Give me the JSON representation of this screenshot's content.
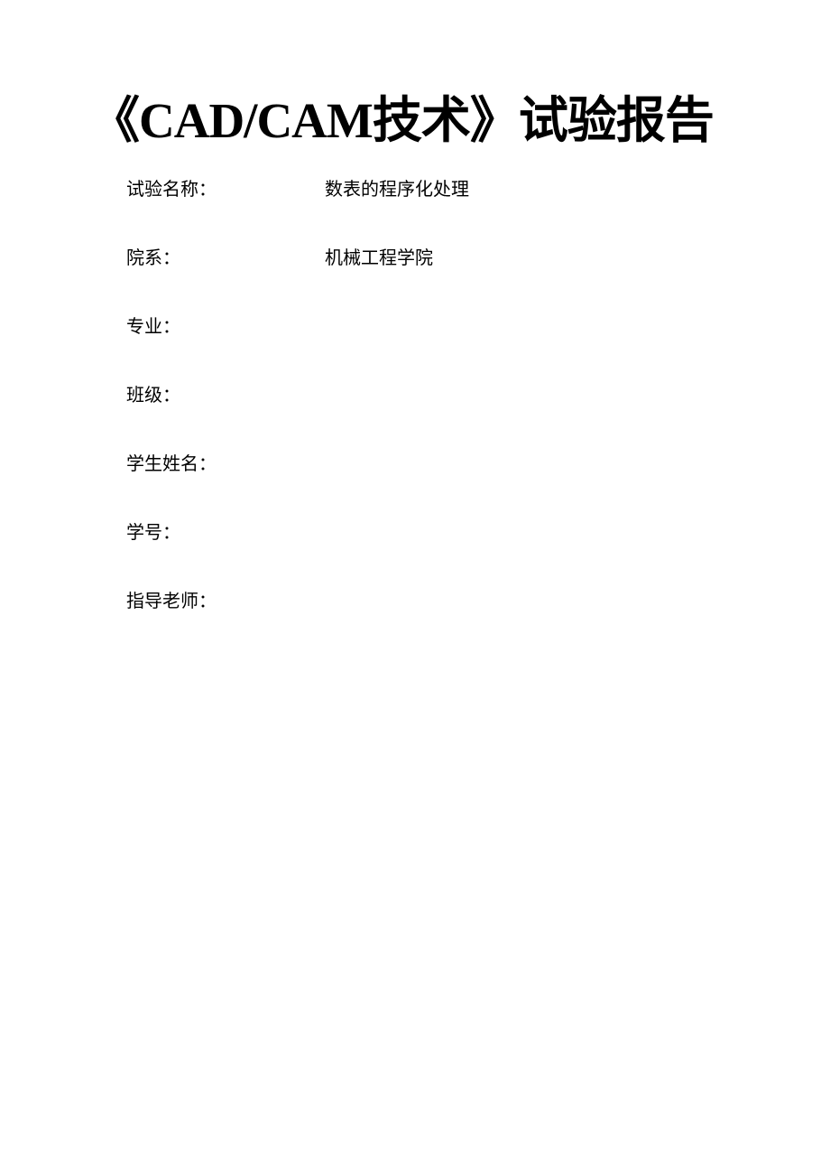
{
  "title": {
    "prefix": "《",
    "latin": "CAD/CAM",
    "cn": "技术》试验报告"
  },
  "fields": [
    {
      "label": "试验名称：",
      "value": "数表的程序化处理"
    },
    {
      "label": "院系：",
      "value": "机械工程学院"
    },
    {
      "label": "专业：",
      "value": ""
    },
    {
      "label": "班级：",
      "value": ""
    },
    {
      "label": "学生姓名：",
      "value": ""
    },
    {
      "label": "学号：",
      "value": ""
    },
    {
      "label": "指导老师：",
      "value": ""
    }
  ]
}
